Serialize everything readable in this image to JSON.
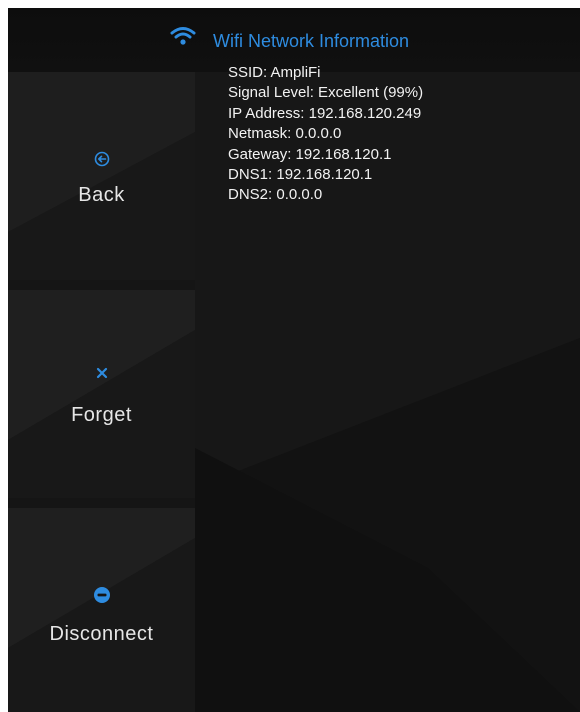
{
  "header": {
    "title": "Wifi Network Information",
    "icon": "wifi-icon",
    "accent_color": "#2e8ce0"
  },
  "sidebar": {
    "buttons": [
      {
        "id": "back",
        "label": "Back",
        "icon": "arrow-left-circle-icon"
      },
      {
        "id": "forget",
        "label": "Forget",
        "icon": "close-icon"
      },
      {
        "id": "disconnect",
        "label": "Disconnect",
        "icon": "minus-circle-icon"
      }
    ]
  },
  "network": {
    "ssid": "SSID: AmpliFi",
    "signal_level": "Signal Level: Excellent (99%)",
    "ip_address": "IP Address: 192.168.120.249",
    "netmask": "Netmask: 0.0.0.0",
    "gateway": "Gateway: 192.168.120.1",
    "dns1": "DNS1: 192.168.120.1",
    "dns2": "DNS2: 0.0.0.0"
  },
  "colors": {
    "background": "#141414",
    "text": "#f2f2f2",
    "button_label": "#e6e6e6",
    "icon_accent": "#2e8ce0"
  }
}
